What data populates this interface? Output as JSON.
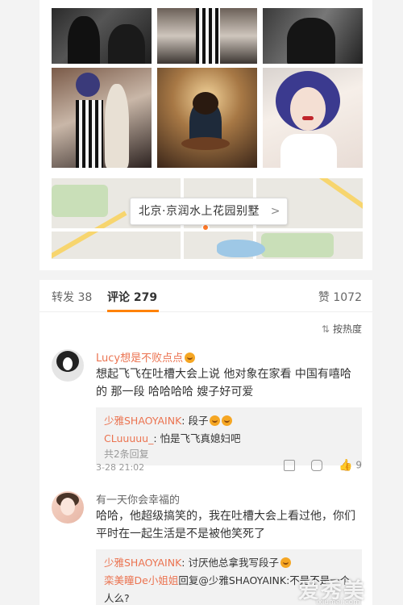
{
  "location": {
    "label": "北京·京润水上花园别墅"
  },
  "tabs": {
    "forward": "转发 38",
    "comment": "评论 279",
    "like": "赞 1072"
  },
  "sort": {
    "label": "按热度"
  },
  "comments": [
    {
      "user": "Lucy想是不败点点",
      "text": "想起飞飞在吐槽大会上说 他对象在家看 中国有嘻哈 的 那一段 哈哈哈哈 嫂子好可爱",
      "replies": [
        {
          "user": "少雅SHAOYAINK",
          "text": ": 段子"
        },
        {
          "user": "CLuuuuu_",
          "text": ": 怕是飞飞真媳妇吧"
        }
      ],
      "more": "共2条回复",
      "time": "3-28 21:02",
      "likes": "9"
    },
    {
      "user": "有一天你会幸福的",
      "text": "哈哈，他超级搞笑的，我在吐槽大会上看过他，你们平时在一起生活是不是被他笑死了",
      "replies": [
        {
          "user": "少雅SHAOYAINK",
          "text": ": 讨厌他总拿我写段子"
        },
        {
          "user": "栾美瞳De小姐姐",
          "text": "回复@少雅SHAOYAINK:不是不是一个人么?"
        }
      ]
    }
  ],
  "watermark": {
    "brand": "爱秀美",
    "url": "ixiumei.com"
  }
}
